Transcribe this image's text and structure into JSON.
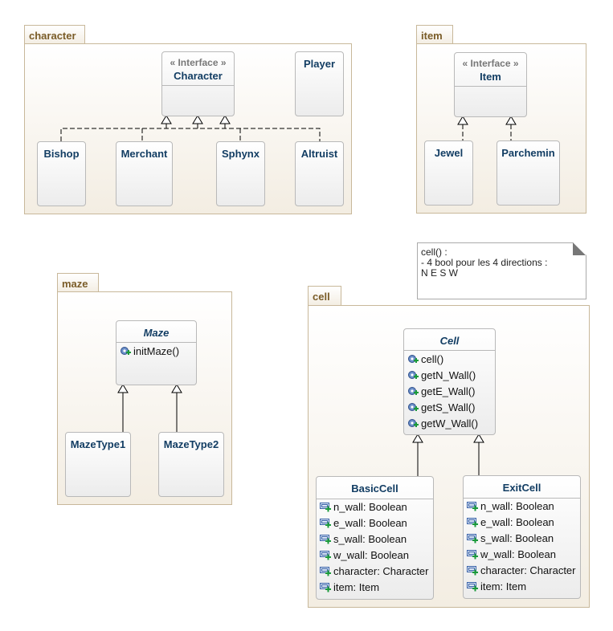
{
  "packages": {
    "character": "character",
    "item": "item",
    "maze": "maze",
    "cell": "cell"
  },
  "stereotype": "« Interface »",
  "classes": {
    "character": "Character",
    "player": "Player",
    "bishop": "Bishop",
    "merchant": "Merchant",
    "sphynx": "Sphynx",
    "altruist": "Altruist",
    "item": "Item",
    "jewel": "Jewel",
    "parchemin": "Parchemin",
    "maze": "Maze",
    "mazetype1": "MazeType1",
    "mazetype2": "MazeType2",
    "cell": "Cell",
    "basiccell": "BasicCell",
    "exitcell": "ExitCell"
  },
  "maze_methods": [
    "initMaze()"
  ],
  "cell_methods": [
    "cell()",
    "getN_Wall()",
    "getE_Wall()",
    "getS_Wall()",
    "getW_Wall()"
  ],
  "cell_attributes": [
    "n_wall: Boolean",
    "e_wall: Boolean",
    "s_wall: Boolean",
    "w_wall: Boolean",
    "character: Character",
    "item: Item"
  ],
  "note": {
    "lines": [
      "cell() :",
      "- 4 bool pour les 4 directions :",
      "N E S W"
    ]
  },
  "icons": {
    "method": "gear-plus-icon",
    "attribute": "field-plus-icon"
  }
}
